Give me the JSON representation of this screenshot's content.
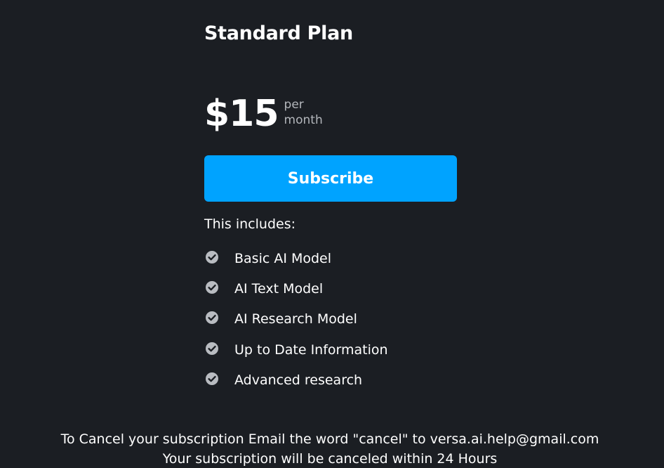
{
  "plan": {
    "title": "Standard Plan",
    "price": "$15",
    "price_unit_line1": "per",
    "price_unit_line2": "month",
    "subscribe_label": "Subscribe",
    "includes_label": "This includes:",
    "features": [
      {
        "label": "Basic AI Model",
        "icon": "check-circle-icon"
      },
      {
        "label": "AI Text Model",
        "icon": "check-circle-icon"
      },
      {
        "label": "AI Research Model",
        "icon": "check-circle-icon"
      },
      {
        "label": "Up to Date Information",
        "icon": "check-circle-icon"
      },
      {
        "label": "Advanced research",
        "icon": "check-circle-icon"
      }
    ]
  },
  "footer": {
    "line1": "To Cancel your subscription Email the word \"cancel\" to versa.ai.help@gmail.com",
    "line2": "Your subscription will be canceled within 24 Hours"
  },
  "colors": {
    "background": "#1b1e23",
    "accent": "#00a3ff",
    "text": "#ffffff",
    "muted": "#b3b6bb",
    "check_icon": "#b9bcc1"
  }
}
